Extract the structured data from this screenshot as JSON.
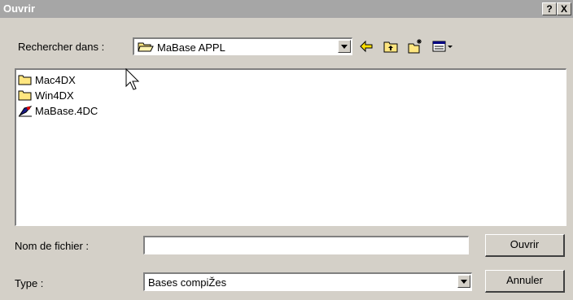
{
  "window": {
    "title": "Ouvrir",
    "help_label": "?",
    "close_label": "X"
  },
  "lookin": {
    "label": "Rechercher dans :",
    "value": "MaBase APPL"
  },
  "toolbar": {
    "icons": [
      "back-icon",
      "up-folder-icon",
      "new-folder-icon",
      "view-menu-icon"
    ]
  },
  "files": [
    {
      "name": "Mac4DX",
      "icon": "folder-icon"
    },
    {
      "name": "Win4DX",
      "icon": "folder-icon"
    },
    {
      "name": "MaBase.4DC",
      "icon": "4d-database-icon"
    }
  ],
  "filename": {
    "label": "Nom de fichier :",
    "value": ""
  },
  "filetype": {
    "label": "Type :",
    "value": "Bases compiŽes"
  },
  "buttons": {
    "open": "Ouvrir",
    "cancel": "Annuler"
  },
  "colors": {
    "titlebar": "#a6a6a6",
    "dialog_bg": "#d4d0c8",
    "folder_yellow": "#ffe680"
  }
}
